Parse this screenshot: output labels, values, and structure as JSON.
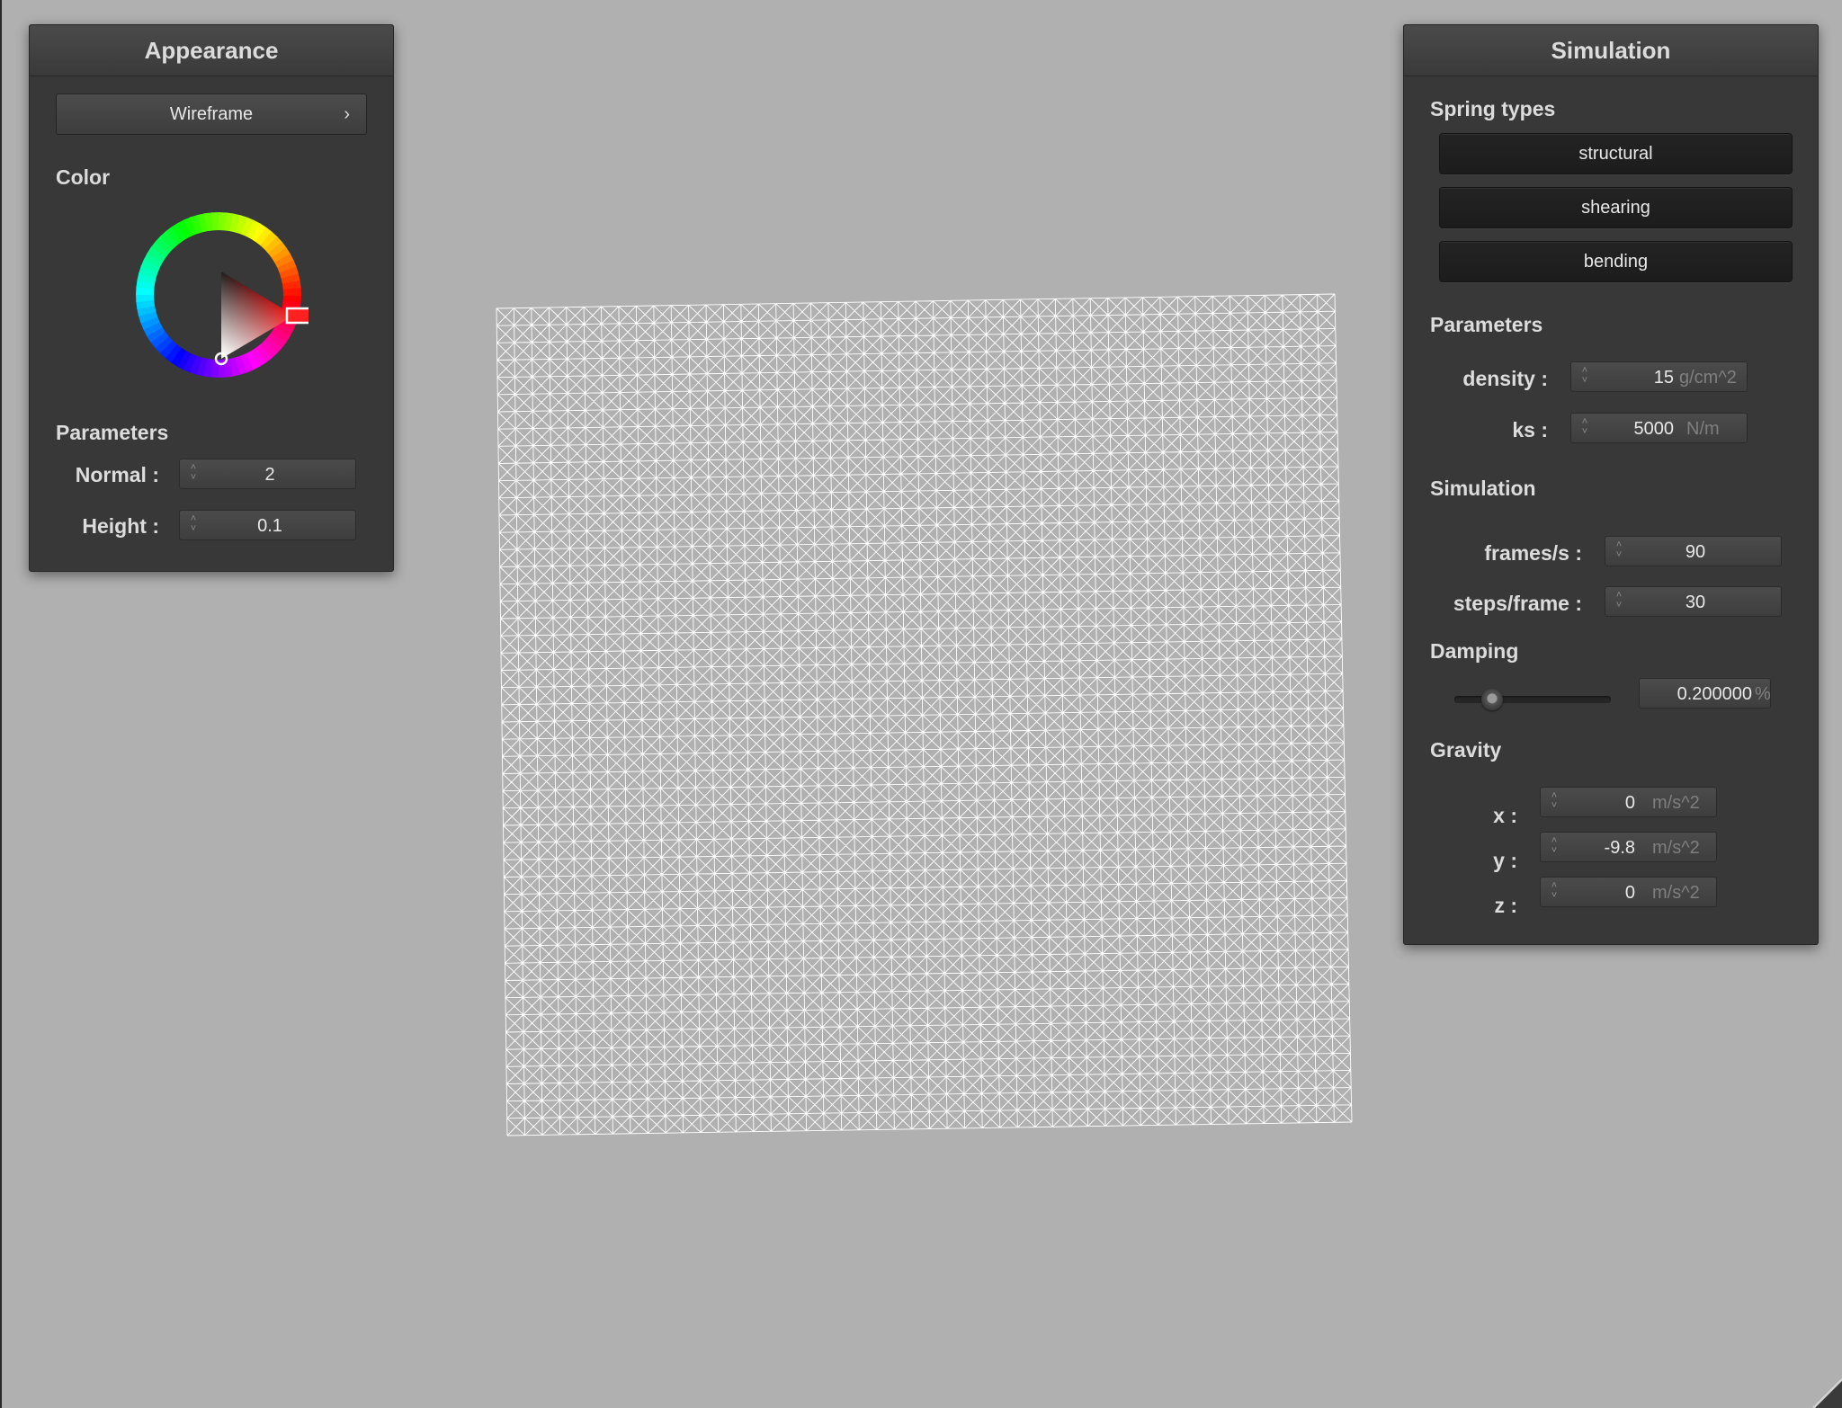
{
  "appearance": {
    "title": "Appearance",
    "render_mode": "Wireframe",
    "color_label": "Color",
    "selected_color": "#ff0000",
    "parameters_label": "Parameters",
    "normal_label": "Normal :",
    "normal_value": "2",
    "height_label": "Height :",
    "height_value": "0.1"
  },
  "simulation_panel": {
    "title": "Simulation",
    "spring_types_label": "Spring types",
    "spring_buttons": [
      "structural",
      "shearing",
      "bending"
    ],
    "parameters_label": "Parameters",
    "density_label": "density :",
    "density_value": "15",
    "density_unit": "g/cm^2",
    "ks_label": "ks :",
    "ks_value": "5000",
    "ks_unit": "N/m",
    "simulation_label": "Simulation",
    "fps_label": "frames/s :",
    "fps_value": "90",
    "steps_label": "steps/frame :",
    "steps_value": "30",
    "damping_label": "Damping",
    "damping_value": "0.200000",
    "damping_unit": "%",
    "damping_slider_fraction": 0.2,
    "gravity_label": "Gravity",
    "gravity_x_label": "x :",
    "gravity_x_value": "0",
    "gravity_y_label": "y :",
    "gravity_y_value": "-9.8",
    "gravity_z_label": "z :",
    "gravity_z_value": "0",
    "gravity_unit": "m/s^2"
  },
  "icons": {
    "spinner": "spinner-arrows-icon",
    "chevron": "chevron-right-icon",
    "color_wheel": "color-wheel-icon",
    "resize_grip": "resize-grip-icon"
  },
  "colors": {
    "background": "#b0b0b0",
    "panel": "#383838",
    "cloth_wire": "#ffffff"
  }
}
